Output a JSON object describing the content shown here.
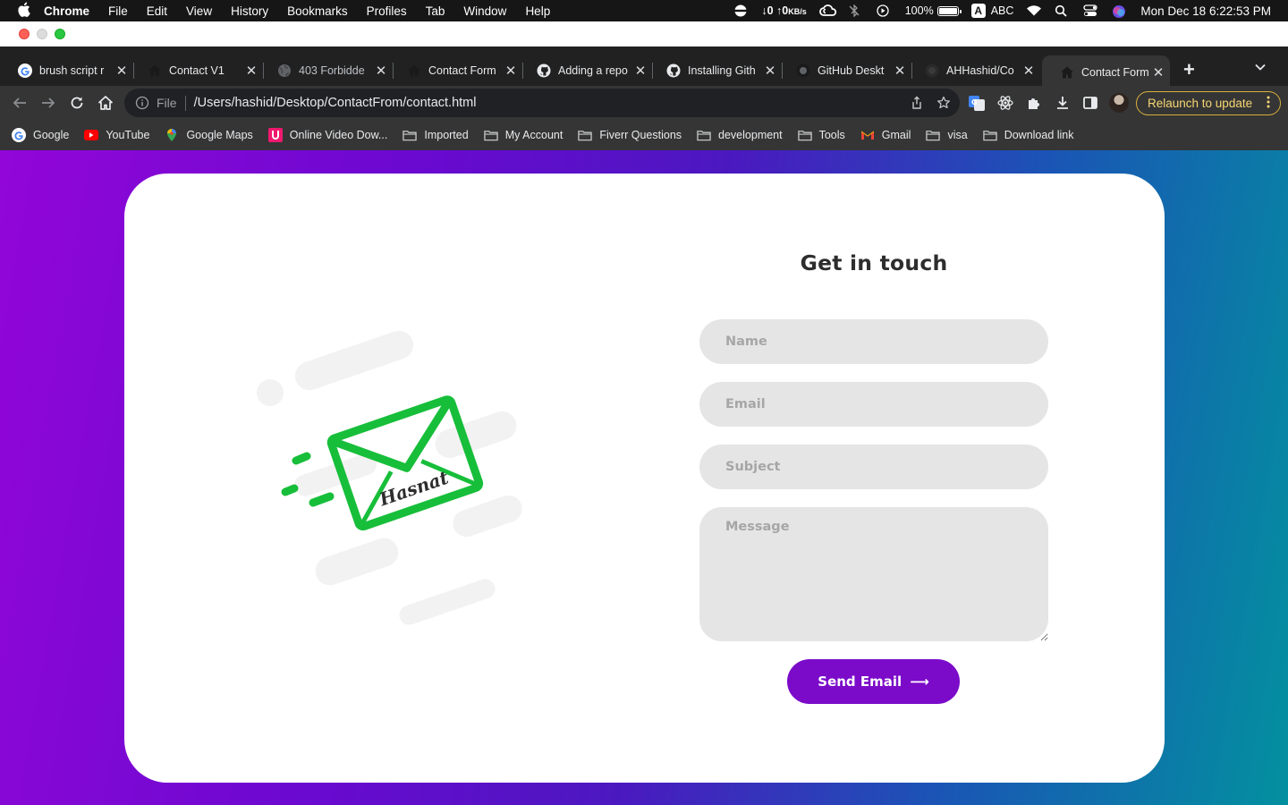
{
  "menubar": {
    "app_name": "Chrome",
    "menus": [
      "File",
      "Edit",
      "View",
      "History",
      "Bookmarks",
      "Profiles",
      "Tab",
      "Window",
      "Help"
    ],
    "network_down": "↓0",
    "network_up": "↑0",
    "network_unit": "KB/s",
    "battery_percent": "100%",
    "battery_level": 1.0,
    "input_source_letter": "A",
    "input_source": "ABC",
    "datetime": "Mon Dec 18  6:22:53 PM"
  },
  "tabs": [
    {
      "title": "brush script r",
      "icon": "google-icon",
      "active": false
    },
    {
      "title": "Contact V1",
      "icon": "house-icon",
      "active": false
    },
    {
      "title": "403 Forbidde",
      "icon": "globe-icon",
      "active": false
    },
    {
      "title": "Contact Form",
      "icon": "house-icon",
      "active": false
    },
    {
      "title": "Adding a repo",
      "icon": "github-icon",
      "active": false
    },
    {
      "title": "Installing Gith",
      "icon": "github-icon",
      "active": false
    },
    {
      "title": "GitHub Deskt",
      "icon": "github-icon",
      "active": false
    },
    {
      "title": "AHHashid/Co",
      "icon": "github-icon",
      "active": false
    },
    {
      "title": "Contact Form",
      "icon": "house-icon",
      "active": true
    }
  ],
  "tab_close_glyph": "✕",
  "new_tab_glyph": "+",
  "address_bar": {
    "scheme_label": "File",
    "url": "/Users/hashid/Desktop/ContactFrom/contact.html"
  },
  "relaunch_label": "Relaunch to update",
  "bookmarks": [
    {
      "label": "Google",
      "icon": "google-icon"
    },
    {
      "label": "YouTube",
      "icon": "youtube-icon"
    },
    {
      "label": "Google Maps",
      "icon": "maps-icon"
    },
    {
      "label": "Online Video Dow...",
      "icon": "video-download-icon"
    },
    {
      "label": "Imported",
      "icon": "folder-icon"
    },
    {
      "label": "My Account",
      "icon": "folder-icon"
    },
    {
      "label": "Fiverr Questions",
      "icon": "folder-icon"
    },
    {
      "label": "development",
      "icon": "folder-icon"
    },
    {
      "label": "Tools",
      "icon": "folder-icon"
    },
    {
      "label": "Gmail",
      "icon": "gmail-icon"
    },
    {
      "label": "visa",
      "icon": "folder-icon"
    },
    {
      "label": "Download link",
      "icon": "folder-icon"
    }
  ],
  "contact": {
    "title": "Get in touch",
    "name_placeholder": "Name",
    "email_placeholder": "Email",
    "subject_placeholder": "Subject",
    "message_placeholder": "Message",
    "send_label": "Send Email",
    "send_arrow": "⟶",
    "envelope_signature": "Hasnat"
  },
  "colors": {
    "accent_button": "#7b0bc9",
    "envelope_green": "#17be3a",
    "gradient_start": "#9206d8",
    "gradient_end": "#03909f",
    "relaunch_yellow": "#f8d773"
  }
}
